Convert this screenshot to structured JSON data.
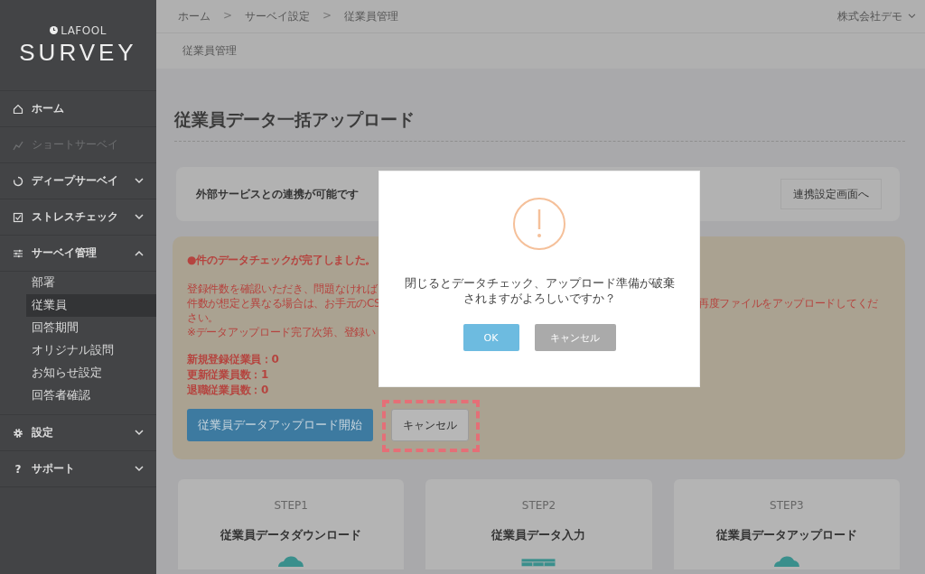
{
  "sidebar": {
    "logo": {
      "brand": "LAFOOL",
      "title": "SURVEY"
    },
    "items": [
      {
        "label": "ホーム",
        "kind": "home",
        "disabled": false
      },
      {
        "label": "ショートサーベイ",
        "kind": "chart",
        "disabled": true
      },
      {
        "label": "ディープサーベイ",
        "kind": "spinner",
        "disabled": false,
        "expanded": false
      },
      {
        "label": "ストレスチェック",
        "kind": "check",
        "disabled": false,
        "expanded": false
      },
      {
        "label": "サーベイ管理",
        "kind": "sliders",
        "disabled": false,
        "expanded": true,
        "children": [
          {
            "label": "部署",
            "selected": false
          },
          {
            "label": "従業員",
            "selected": true
          },
          {
            "label": "回答期間",
            "selected": false
          },
          {
            "label": "オリジナル設問",
            "selected": false
          },
          {
            "label": "お知らせ設定",
            "selected": false
          },
          {
            "label": "回答者確認",
            "selected": false
          }
        ]
      },
      {
        "label": "設定",
        "kind": "gear",
        "disabled": false,
        "expanded": false
      },
      {
        "label": "サポート",
        "kind": "help",
        "icon_char": "?",
        "disabled": false,
        "expanded": false
      }
    ]
  },
  "header": {
    "breadcrumb": [
      {
        "kind": "link",
        "label": "ホーム"
      },
      {
        "kind": "separator",
        "label": ">"
      },
      {
        "kind": "link",
        "label": "サーベイ設定"
      },
      {
        "kind": "separator",
        "label": ">"
      },
      {
        "kind": "current",
        "label": "従業員管理"
      }
    ],
    "company": "株式会社デモ"
  },
  "subheader": {
    "title": "従業員管理"
  },
  "page_title": "従業員データ一括アップロード",
  "integration": {
    "text": "外部サービスとの連携が可能です",
    "button": "連携設定画面へ"
  },
  "notice": {
    "heading": "●件のデータチェックが完了しました。",
    "lines": [
      {
        "left": "登録件数を確認いただき、問題なければ"
      },
      {
        "left": "件数が想定と異なる場合は、お手元のCS",
        "right": "再度ファイルをアップロードしてくだ"
      },
      {
        "left": "さい。"
      },
      {
        "left": "※データアップロード完了次第、登録い"
      }
    ],
    "counts": [
      "新規登録従業員：0",
      "更新従業員数：1",
      "退職従業員数：0"
    ],
    "upload_button": "従業員データアップロード開始",
    "cancel_button": "キャンセル",
    "cancel_highlighted": true
  },
  "steps": [
    {
      "step": "STEP1",
      "title": "従業員データダウンロード",
      "kind": "cloud"
    },
    {
      "step": "STEP2",
      "title": "従業員データ入力",
      "kind": "table"
    },
    {
      "step": "STEP3",
      "title": "従業員データアップロード",
      "kind": "cloud"
    }
  ],
  "dialog": {
    "message": "閉じるとデータチェック、アップロード準備が破棄されますがよろしいですか？",
    "ok": "OK",
    "cancel": "キャンセル"
  }
}
